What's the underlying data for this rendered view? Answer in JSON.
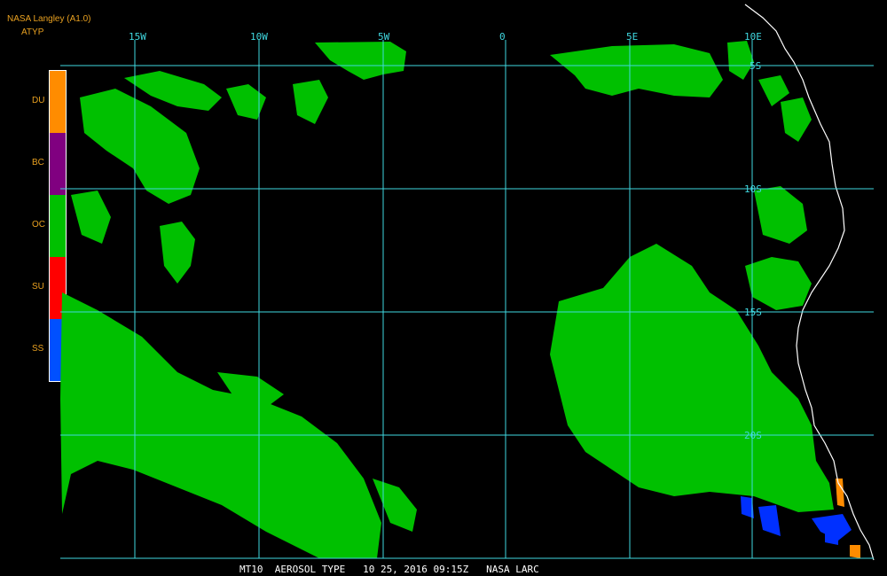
{
  "header": {
    "credit": "NASA Langley (A1.0)",
    "product": "ATYP"
  },
  "legend": [
    {
      "label": "DU",
      "color": "#ff8c00"
    },
    {
      "label": "BC",
      "color": "#800080"
    },
    {
      "label": "OC",
      "color": "#00c000"
    },
    {
      "label": "SU",
      "color": "#ff0000"
    },
    {
      "label": "SS",
      "color": "#0050ff"
    }
  ],
  "grid": {
    "color": "#40d8e0",
    "longitudes": [
      "15W",
      "10W",
      "5W",
      "0",
      "5E",
      "10E"
    ],
    "latitudes": [
      "5S",
      "10S",
      "15S",
      "20S"
    ]
  },
  "footer": {
    "text": "MT10  AEROSOL TYPE   10 25, 2016 09:15Z   NASA LARC"
  },
  "colors": {
    "background": "#000000",
    "coastline": "#ffffff",
    "label": "#e8a020"
  }
}
